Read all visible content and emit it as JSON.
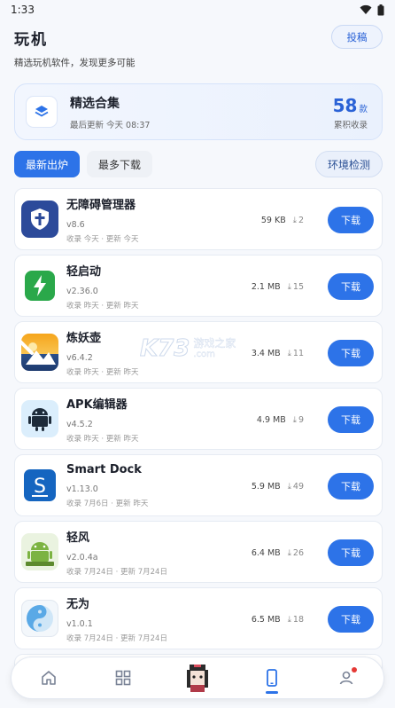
{
  "status_bar": {
    "time": "1:33"
  },
  "header": {
    "title": "玩机",
    "subtitle": "精选玩机软件，发现更多可能",
    "submit_label": "投稿"
  },
  "collection": {
    "title": "精选合集",
    "updated": "最后更新 今天 08:37",
    "count": "58",
    "unit": "款",
    "count_label": "累积收录"
  },
  "tabs": [
    {
      "label": "最新出炉",
      "active": true
    },
    {
      "label": "最多下载",
      "active": false
    }
  ],
  "env_check_label": "环境检测",
  "apps": [
    {
      "name": "无障碍管理器",
      "version": "v8.6",
      "meta": "收录 今天 · 更新 今天",
      "size": "59 KB",
      "downloads": "2",
      "button": "下载"
    },
    {
      "name": "轻启动",
      "version": "v2.36.0",
      "meta": "收录 昨天 · 更新 昨天",
      "size": "2.1 MB",
      "downloads": "15",
      "button": "下载"
    },
    {
      "name": "炼妖壶",
      "version": "v6.4.2",
      "meta": "收录 昨天 · 更新 昨天",
      "size": "3.4 MB",
      "downloads": "11",
      "button": "下载"
    },
    {
      "name": "APK编辑器",
      "version": "v4.5.2",
      "meta": "收录 昨天 · 更新 昨天",
      "size": "4.9 MB",
      "downloads": "9",
      "button": "下载"
    },
    {
      "name": "Smart Dock",
      "version": "v1.13.0",
      "meta": "收录 7月6日 · 更新 昨天",
      "size": "5.9 MB",
      "downloads": "49",
      "button": "下载"
    },
    {
      "name": "轻风",
      "version": "v2.0.4a",
      "meta": "收录 7月24日 · 更新 7月24日",
      "size": "6.4 MB",
      "downloads": "26",
      "button": "下载"
    },
    {
      "name": "无为",
      "version": "v1.0.1",
      "meta": "收录 7月24日 · 更新 7月24日",
      "size": "6.5 MB",
      "downloads": "18",
      "button": "下载"
    }
  ],
  "watermark": {
    "brand": "K73",
    "site": "游戏之家",
    "domain": ".com"
  },
  "colors": {
    "accent": "#2d73e8",
    "background": "#f6f8fc"
  }
}
